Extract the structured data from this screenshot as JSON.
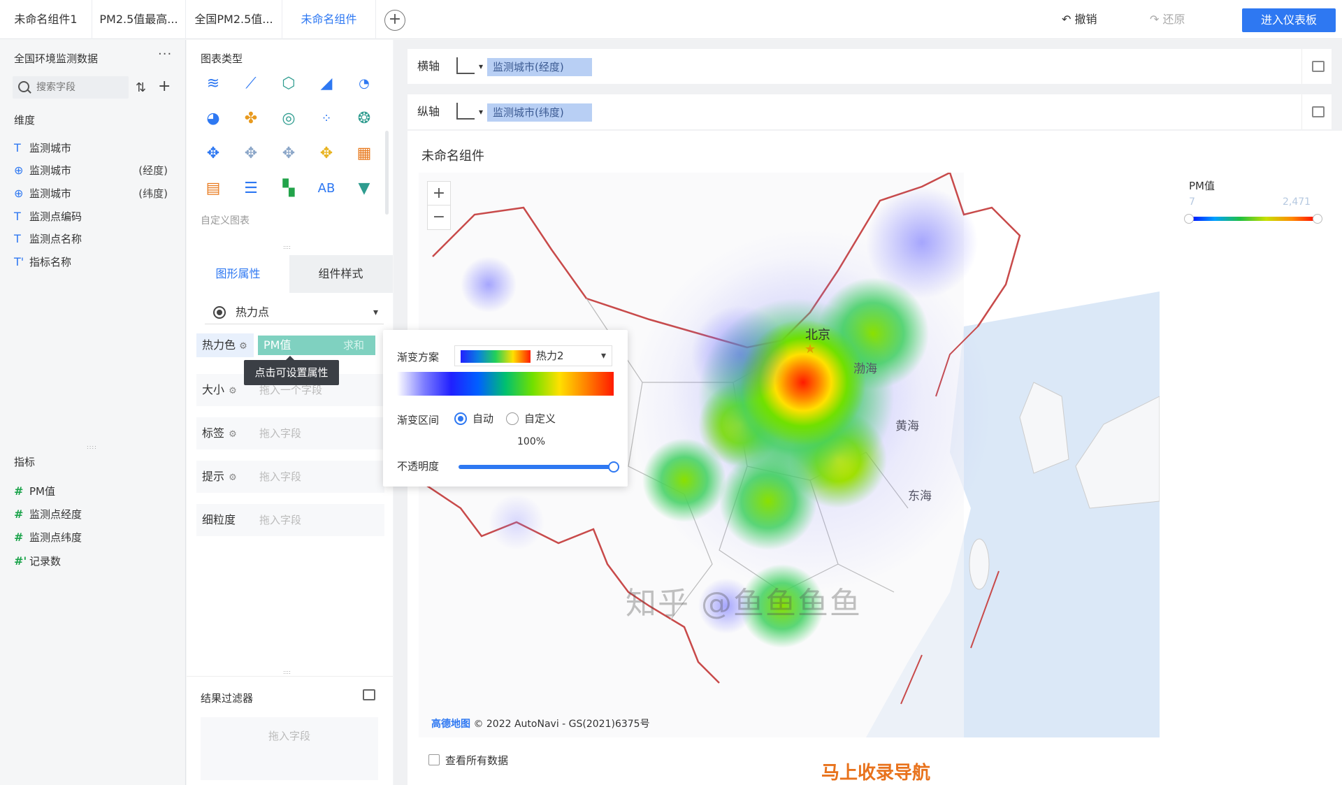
{
  "tabs": [
    "未命名组件1",
    "PM2.5值最高...",
    "全国PM2.5值...",
    "未命名组件"
  ],
  "topbar": {
    "undo": "撤销",
    "redo": "还原",
    "enter_dashboard": "进入仪表板"
  },
  "left": {
    "dataset_title": "全国环境监测数据",
    "more": "···",
    "search_placeholder": "搜索字段",
    "dimensions_label": "维度",
    "dimensions": [
      {
        "icon": "T",
        "name": "监测城市",
        "suffix": ""
      },
      {
        "icon": "globe",
        "name": "监测城市",
        "suffix": "(经度)"
      },
      {
        "icon": "globe",
        "name": "监测城市",
        "suffix": "(纬度)"
      },
      {
        "icon": "T",
        "name": "监测点编码",
        "suffix": ""
      },
      {
        "icon": "T",
        "name": "监测点名称",
        "suffix": ""
      },
      {
        "icon": "T'",
        "name": "指标名称",
        "suffix": ""
      }
    ],
    "metrics_label": "指标",
    "metrics": [
      {
        "icon": "#",
        "name": "PM值"
      },
      {
        "icon": "#",
        "name": "监测点经度"
      },
      {
        "icon": "#",
        "name": "监测点纬度"
      },
      {
        "icon": "#'",
        "name": "记录数"
      }
    ]
  },
  "mid": {
    "chart_types_label": "图表类型",
    "custom_chart": "自定义图表",
    "prop_tabs": [
      "图形属性",
      "组件样式"
    ],
    "shape_select": "热力点",
    "rows": {
      "heat_color": "热力色",
      "heat_field": "PM值",
      "heat_agg": "求和",
      "tooltip": "点击可设置属性",
      "size": "大小",
      "size_placeholder": "拖入一个字段",
      "label": "标签",
      "label_placeholder": "拖入字段",
      "hint": "提示",
      "hint_placeholder": "拖入字段",
      "granularity": "细粒度",
      "granularity_placeholder": "拖入字段"
    },
    "filter_title": "结果过滤器",
    "filter_placeholder": "拖入字段"
  },
  "popup": {
    "scheme_label": "渐变方案",
    "scheme_value": "热力2",
    "range_label": "渐变区间",
    "auto": "自动",
    "custom": "自定义",
    "percent": "100%",
    "opacity_label": "不透明度",
    "opacity": 1.0
  },
  "canvas": {
    "x_axis_label": "横轴",
    "x_axis_field": "监测城市(经度)",
    "y_axis_label": "纵轴",
    "y_axis_field": "监测城市(纬度)",
    "component_title": "未命名组件",
    "map_labels": {
      "beijing": "北京",
      "bohai": "渤海",
      "huanghai": "黄海",
      "donghai": "东海"
    },
    "attribution_brand": "高德地图",
    "attribution_text": "© 2022 AutoNavi - GS(2021)6375号",
    "legend_title": "PM值",
    "legend_min": "7",
    "legend_max": "2,471",
    "show_all": "查看所有数据",
    "watermark": "知乎 @鱼鱼鱼鱼",
    "watermark2": "马上收录导航"
  },
  "colors": {
    "accent": "#2e78f2",
    "pill_teal": "#7fd1c0",
    "axis_pill": "#b8cff4"
  }
}
